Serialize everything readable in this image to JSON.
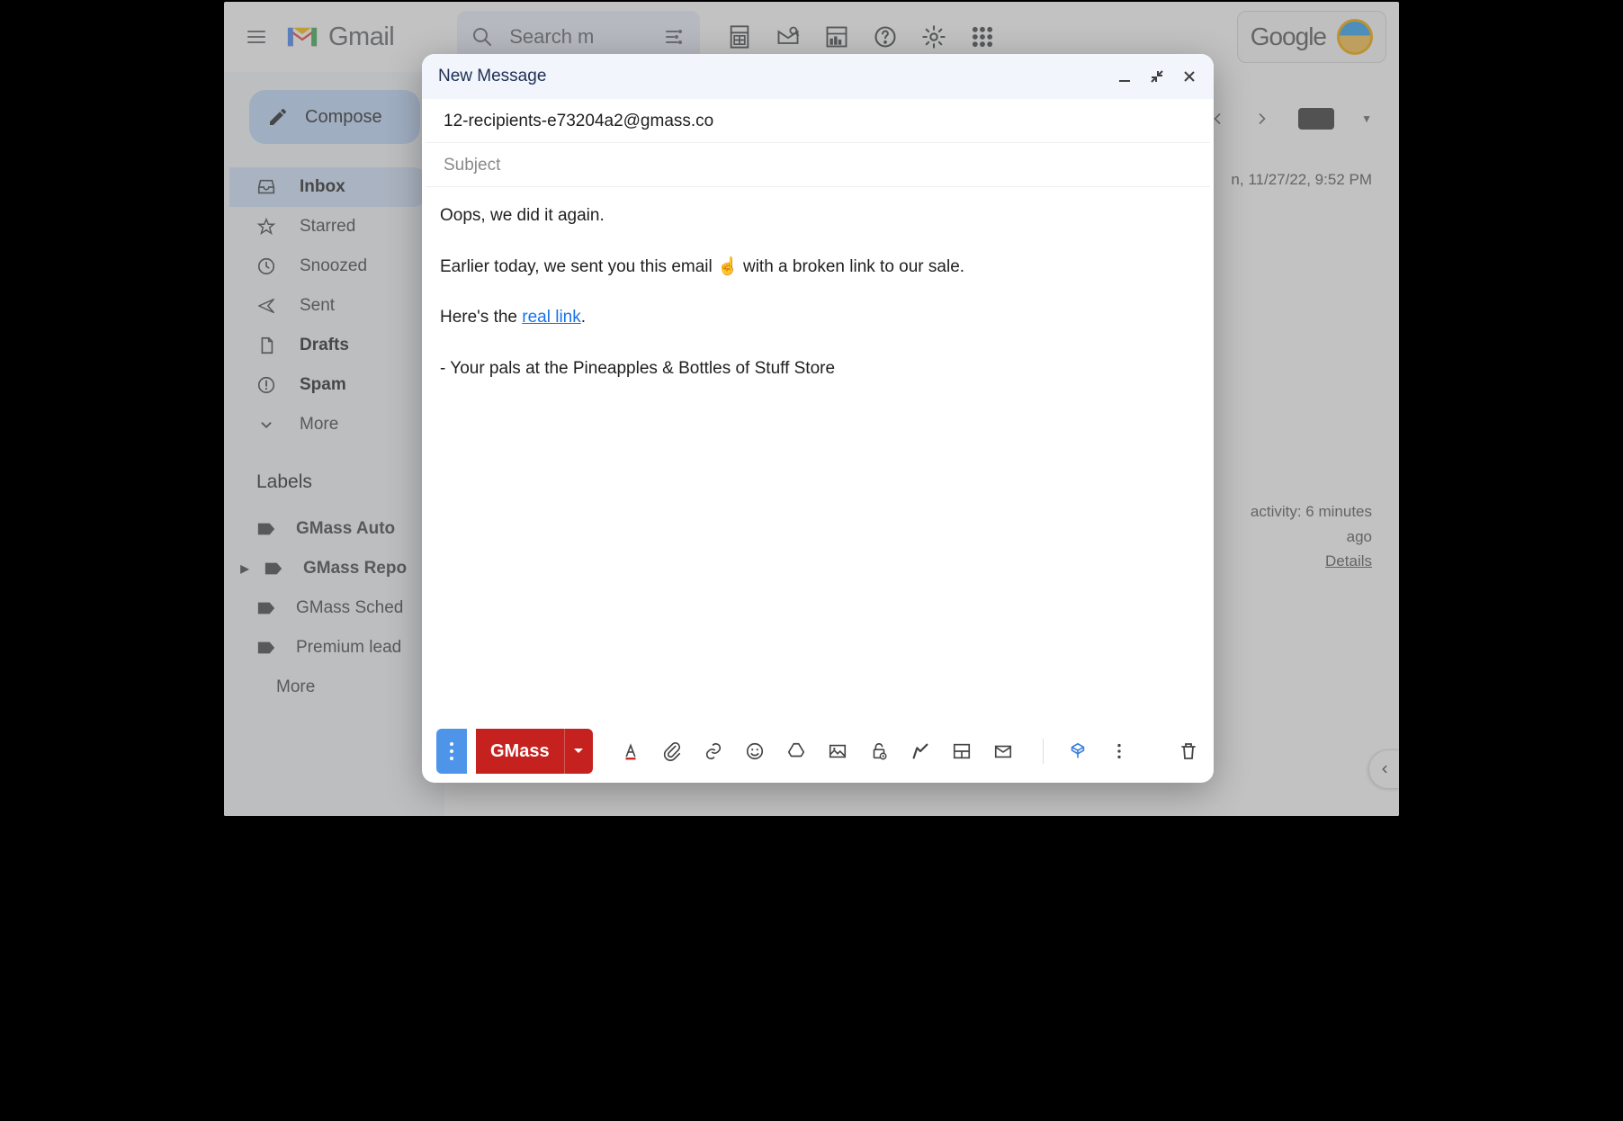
{
  "header": {
    "app_name": "Gmail",
    "search_placeholder": "Search m",
    "google_label": "Google"
  },
  "sidebar": {
    "compose_label": "Compose",
    "items": [
      {
        "label": "Inbox",
        "icon": "inbox",
        "bold": true,
        "active": true
      },
      {
        "label": "Starred",
        "icon": "star"
      },
      {
        "label": "Snoozed",
        "icon": "clock"
      },
      {
        "label": "Sent",
        "icon": "send"
      },
      {
        "label": "Drafts",
        "icon": "file",
        "bold": true
      },
      {
        "label": "Spam",
        "icon": "alert",
        "bold": true
      },
      {
        "label": "More",
        "icon": "chevron"
      }
    ],
    "labels_heading": "Labels",
    "labels": [
      {
        "label": "GMass Auto Followups",
        "bold": true,
        "trunc": "GMass Auto"
      },
      {
        "label": "GMass Reports",
        "bold": true,
        "expandable": true,
        "trunc": "GMass Repo"
      },
      {
        "label": "GMass Scheduled",
        "trunc": "GMass Sched"
      },
      {
        "label": "Premium leads",
        "trunc": "Premium lead"
      },
      {
        "label": "More",
        "icon": "chevron"
      }
    ]
  },
  "main": {
    "thread_date": "n, 11/27/22, 9:52 PM",
    "activity_line1": "activity: 6 minutes",
    "activity_line2": "ago",
    "details_label": "Details"
  },
  "compose_window": {
    "title": "New Message",
    "to": "12-recipients-e73204a2@gmass.co",
    "subject_placeholder": "Subject",
    "body": {
      "p1": "Oops, we did it again.",
      "p2a": "Earlier today, we sent you this email ",
      "p2b": " with a broken link to our sale.",
      "p3a": "Here's the ",
      "link_text": "real link",
      "p3b": ".",
      "p4": "- Your pals at the Pineapples & Bottles of Stuff Store"
    },
    "gmass_label": "GMass"
  }
}
